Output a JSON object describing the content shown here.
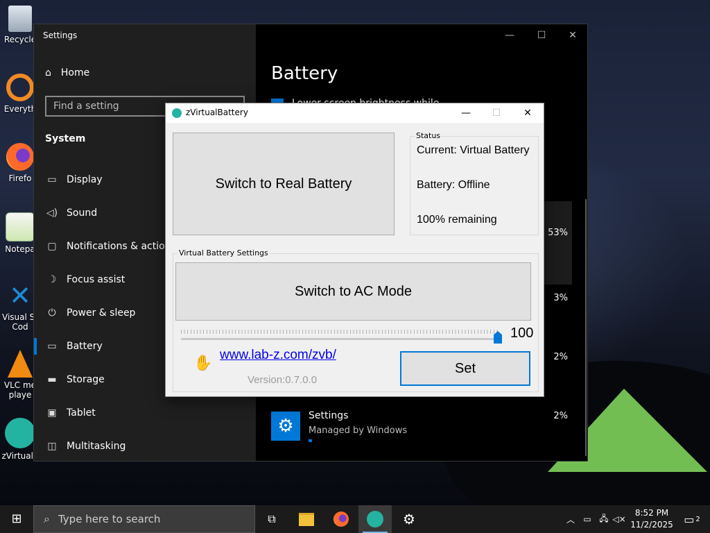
{
  "desktop": {
    "icons": [
      {
        "label": "Recycle",
        "icon": "recycle-bin-icon"
      },
      {
        "label": "Everyth",
        "icon": "everything-search-icon"
      },
      {
        "label": "Firefo",
        "icon": "firefox-icon"
      },
      {
        "label": "Notepa",
        "icon": "notepad-icon"
      },
      {
        "label": "Visual St",
        "label2": "Cod",
        "icon": "vscode-icon"
      },
      {
        "label": "VLC me",
        "label2": "playe",
        "icon": "vlc-icon"
      },
      {
        "label": "zVirtualE",
        "icon": "zvirtualbattery-icon"
      }
    ]
  },
  "settings": {
    "window_title": "Settings",
    "home": "Home",
    "search_placeholder": "Find a setting",
    "section": "System",
    "nav": [
      {
        "label": "Display",
        "icon": "display-icon"
      },
      {
        "label": "Sound",
        "icon": "sound-icon"
      },
      {
        "label": "Notifications & actions",
        "icon": "notifications-icon"
      },
      {
        "label": "Focus assist",
        "icon": "focus-assist-icon"
      },
      {
        "label": "Power & sleep",
        "icon": "power-icon"
      },
      {
        "label": "Battery",
        "icon": "battery-icon",
        "selected": true
      },
      {
        "label": "Storage",
        "icon": "storage-icon"
      },
      {
        "label": "Tablet",
        "icon": "tablet-icon"
      },
      {
        "label": "Multitasking",
        "icon": "multitasking-icon"
      }
    ],
    "page_title": "Battery",
    "partial_text": "Lower screen brightness while in batte",
    "usage_percents": [
      "53%",
      "3%",
      "2%",
      "2%"
    ],
    "app_name": "Settings",
    "app_sub": "Managed by Windows"
  },
  "zvb": {
    "title": "zVirtualBattery",
    "switch_real_label": "Switch to Real Battery",
    "status_legend": "Status",
    "status_current": "Current: Virtual Battery",
    "status_battery": "Battery: Offline",
    "status_remaining": "100% remaining",
    "settings_legend": "Virtual Battery Settings",
    "switch_ac_label": "Switch to AC Mode",
    "slider_value": "100",
    "link": "www.lab-z.com/zvb/",
    "version": "Version:0.7.0.0",
    "set_label": "Set"
  },
  "taskbar": {
    "search_placeholder": "Type here to search",
    "time": "8:52 PM",
    "date": "11/2/2025",
    "notification_count": "2",
    "apps": [
      "task-view-icon",
      "file-explorer-icon",
      "firefox-icon",
      "zvirtualbattery-icon",
      "settings-icon"
    ]
  }
}
